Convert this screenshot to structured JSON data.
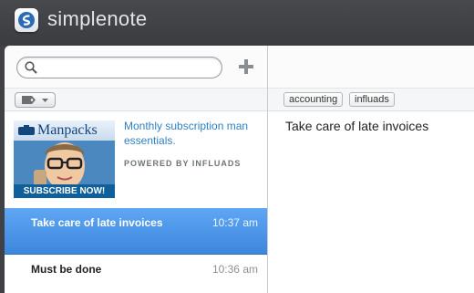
{
  "app": {
    "name": "simplenote"
  },
  "search": {
    "value": "",
    "placeholder": ""
  },
  "ad": {
    "brand": "Manpacks",
    "cta": "SUBSCRIBE NOW!",
    "text": "Monthly subscription man essentials.",
    "powered_by": "POWERED BY INFLUADS"
  },
  "notes": [
    {
      "title": "Take care of late invoices",
      "time": "10:37 am",
      "selected": true
    },
    {
      "title": "Must be done",
      "time": "10:36 am",
      "selected": false
    }
  ],
  "editor": {
    "tags": [
      "accounting",
      "influads"
    ],
    "content": "Take care of late invoices"
  },
  "colors": {
    "titlebar": "#3f4145",
    "selection": "#3c86de",
    "ad_link": "#2f7fc6"
  },
  "icons": {
    "logo": "simplenote-logo-icon",
    "search": "search-icon",
    "add": "plus-icon",
    "tag_filter": "tag-icon",
    "dropdown": "chevron-down-icon"
  }
}
